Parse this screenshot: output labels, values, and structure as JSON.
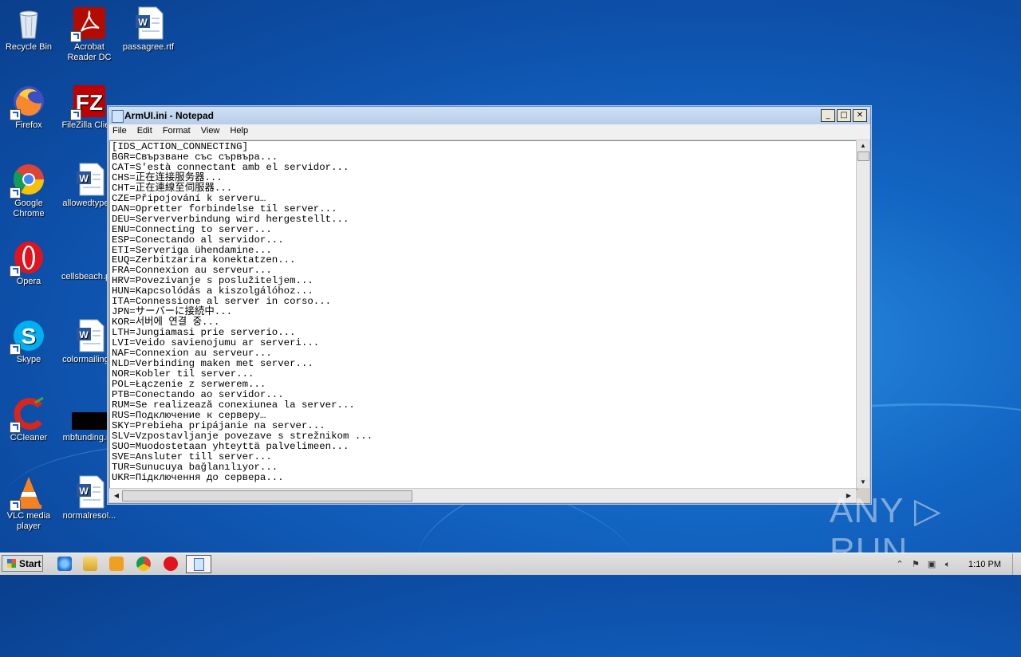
{
  "desktop": {
    "icons": [
      {
        "label": "Recycle Bin"
      },
      {
        "label": "Acrobat Reader DC"
      },
      {
        "label": "passagree.rtf"
      },
      {
        "label": "Firefox"
      },
      {
        "label": "FileZilla Clie..."
      },
      {
        "label": "Google Chrome"
      },
      {
        "label": "allowedtype..."
      },
      {
        "label": "Opera"
      },
      {
        "label": "cellsbeach.p..."
      },
      {
        "label": "Skype"
      },
      {
        "label": "colormailing..."
      },
      {
        "label": "CCleaner"
      },
      {
        "label": "mbfunding.r..."
      },
      {
        "label": "VLC media player"
      },
      {
        "label": "normalresol..."
      }
    ]
  },
  "window": {
    "title": "ArmUI.ini - Notepad",
    "controls": {
      "minimize": "_",
      "maximize": "□",
      "close": "✕"
    },
    "menu": [
      "File",
      "Edit",
      "Format",
      "View",
      "Help"
    ],
    "content": "[IDS_ACTION_CONNECTING]\nBGR=Свързване със сървъра...\nCAT=S'està connectant amb el servidor...\nCHS=正在连接服务器...\nCHT=正在連線至伺服器...\nCZE=Připojování k serveru…\nDAN=Opretter forbindelse til server...\nDEU=Serververbindung wird hergestellt...\nENU=Connecting to server...\nESP=Conectando al servidor...\nETI=Serveriga ühendamine...\nEUQ=Zerbitzarira konektatzen...\nFRA=Connexion au serveur...\nHRV=Povezivanje s poslužiteljem...\nHUN=Kapcsolódás a kiszolgálóhoz...\nITA=Connessione al server in corso...\nJPN=サーバーに接続中...\nKOR=서버에 연결 중...\nLTH=Jungiamasi prie serverio...\nLVI=Veido savienojumu ar serveri...\nNAF=Connexion au serveur...\nNLD=Verbinding maken met server...\nNOR=Kobler til server...\nPOL=Łączenie z serwerem...\nPTB=Conectando ao servidor...\nRUM=Se realizează conexiunea la server...\nRUS=Подключение к серверу…\nSKY=Prebieha pripájanie na server...\nSLV=Vzpostavljanje povezave s strežnikom ...\nSUO=Muodostetaan yhteyttä palvelimeen...\nSVE=Ansluter till server...\nTUR=Sunucuya bağlanılıyor...\nUKR=Підключення до сервера..."
  },
  "taskbar": {
    "start_label": "Start",
    "clock": "1:10 PM"
  },
  "watermark": "ANY ▷ RUN",
  "colors": {
    "desktop": "#1366c4",
    "titlebar": "#c4d7ee",
    "taskbar": "#d8d8d8"
  }
}
